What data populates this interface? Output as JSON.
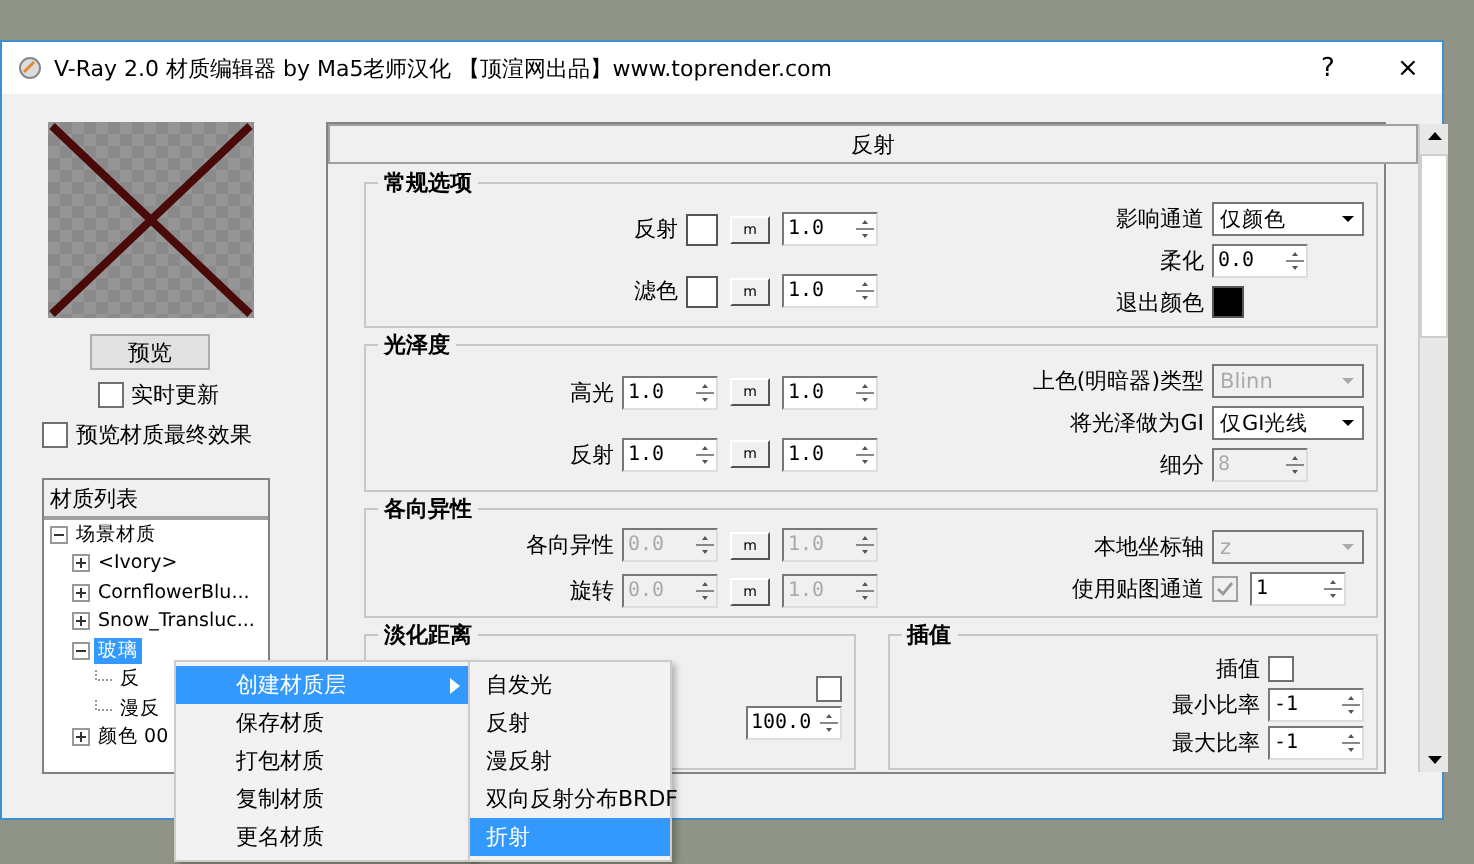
{
  "window": {
    "title": "V-Ray 2.0 材质编辑器 by Ma5老师汉化 【顶渲网出品】www.toprender.com",
    "buttons": [
      "?",
      "×"
    ]
  },
  "preview": {
    "button": "预览",
    "options": [
      {
        "label": "实时更新",
        "checked": false
      },
      {
        "label": "预览材质最终效果",
        "checked": false
      }
    ]
  },
  "material_list": {
    "title": "材质列表",
    "tree": [
      {
        "label": "场景材质",
        "expanded": true,
        "selected": false,
        "children": [
          {
            "label": "<Ivory>",
            "expanded": false,
            "selected": false
          },
          {
            "label": "CornflowerBlu...",
            "expanded": false,
            "selected": false
          },
          {
            "label": "Snow_Transluc...",
            "expanded": false,
            "selected": false
          },
          {
            "label": "玻璃",
            "expanded": true,
            "selected": true,
            "children": [
              {
                "label": "反",
                "selected": false
              },
              {
                "label": "漫反",
                "selected": false
              }
            ]
          },
          {
            "label": "颜色 00",
            "expanded": false,
            "selected": false
          }
        ]
      }
    ]
  },
  "panel": {
    "title": "反射",
    "sections": [
      {
        "title": "常规选项",
        "left": [
          {
            "label": "反射",
            "controls": [
              {
                "kind": "swatch",
                "color": "#ffffff"
              },
              {
                "kind": "map",
                "text": "m"
              },
              {
                "kind": "spin",
                "value": "1.0",
                "disabled": false
              }
            ]
          },
          {
            "label": "滤色",
            "controls": [
              {
                "kind": "swatch",
                "color": "#ffffff"
              },
              {
                "kind": "map",
                "text": "m"
              },
              {
                "kind": "spin",
                "value": "1.0",
                "disabled": false
              }
            ]
          }
        ],
        "right": [
          {
            "label": "影响通道",
            "controls": [
              {
                "kind": "select",
                "value": "仅颜色",
                "disabled": false
              }
            ]
          },
          {
            "label": "柔化",
            "controls": [
              {
                "kind": "spin",
                "value": "0.0",
                "disabled": false
              }
            ]
          },
          {
            "label": "退出颜色",
            "controls": [
              {
                "kind": "swatch",
                "color": "#000000"
              }
            ]
          }
        ]
      },
      {
        "title": "光泽度",
        "left": [
          {
            "label": "高光",
            "controls": [
              {
                "kind": "spin",
                "value": "1.0",
                "disabled": false
              },
              {
                "kind": "map",
                "text": "m"
              },
              {
                "kind": "spin",
                "value": "1.0",
                "disabled": false
              }
            ]
          },
          {
            "label": "反射",
            "controls": [
              {
                "kind": "spin",
                "value": "1.0",
                "disabled": false
              },
              {
                "kind": "map",
                "text": "m"
              },
              {
                "kind": "spin",
                "value": "1.0",
                "disabled": false
              }
            ]
          }
        ],
        "right": [
          {
            "label": "上色(明暗器)类型",
            "controls": [
              {
                "kind": "select",
                "value": "Blinn",
                "disabled": true
              }
            ]
          },
          {
            "label": "将光泽做为GI",
            "controls": [
              {
                "kind": "select",
                "value": "仅GI光线",
                "disabled": false
              }
            ]
          },
          {
            "label": "细分",
            "controls": [
              {
                "kind": "spin",
                "value": "8",
                "disabled": true
              }
            ]
          }
        ]
      },
      {
        "title": "各向异性",
        "left": [
          {
            "label": "各向异性",
            "controls": [
              {
                "kind": "spin",
                "value": "0.0",
                "disabled": true
              },
              {
                "kind": "map",
                "text": "m"
              },
              {
                "kind": "spin",
                "value": "1.0",
                "disabled": true
              }
            ]
          },
          {
            "label": "旋转",
            "controls": [
              {
                "kind": "spin",
                "value": "0.0",
                "disabled": true
              },
              {
                "kind": "map",
                "text": "m"
              },
              {
                "kind": "spin",
                "value": "1.0",
                "disabled": true
              }
            ]
          }
        ],
        "right": [
          {
            "label": "本地坐标轴",
            "controls": [
              {
                "kind": "select",
                "value": "z",
                "disabled": true
              }
            ]
          },
          {
            "label": "使用贴图通道",
            "controls": [
              {
                "kind": "check",
                "checked": true,
                "disabled": true
              },
              {
                "kind": "spin",
                "value": "1",
                "disabled": false
              }
            ]
          }
        ]
      }
    ],
    "bottom_sections": [
      {
        "title": "淡化距离",
        "left": [
          {
            "controls": [
              {
                "kind": "check",
                "checked": false
              }
            ]
          },
          {
            "controls": [
              {
                "kind": "spin",
                "value": "100.0",
                "disabled": false
              }
            ]
          }
        ]
      },
      {
        "title": "插值",
        "left": [
          {
            "label": "插值",
            "controls": [
              {
                "kind": "check",
                "checked": false
              }
            ]
          },
          {
            "label": "最小比率",
            "controls": [
              {
                "kind": "spin",
                "value": "-1",
                "disabled": false
              }
            ]
          },
          {
            "label": "最大比率",
            "controls": [
              {
                "kind": "spin",
                "value": "-1",
                "disabled": false
              }
            ]
          }
        ]
      }
    ]
  },
  "context_menu": {
    "items": [
      {
        "label": "创建材质层",
        "selected": true,
        "submenu": true
      },
      {
        "label": "保存材质",
        "selected": false,
        "submenu": false
      },
      {
        "label": "打包材质",
        "selected": false,
        "submenu": false
      },
      {
        "label": "复制材质",
        "selected": false,
        "submenu": false
      },
      {
        "label": "更名材质",
        "selected": false,
        "submenu": false
      }
    ]
  },
  "submenu": {
    "items": [
      {
        "label": "自发光",
        "selected": false
      },
      {
        "label": "反射",
        "selected": false
      },
      {
        "label": "漫反射",
        "selected": false
      },
      {
        "label": "双向反射分布BRDF",
        "selected": false
      },
      {
        "label": "折射",
        "selected": true
      }
    ]
  }
}
